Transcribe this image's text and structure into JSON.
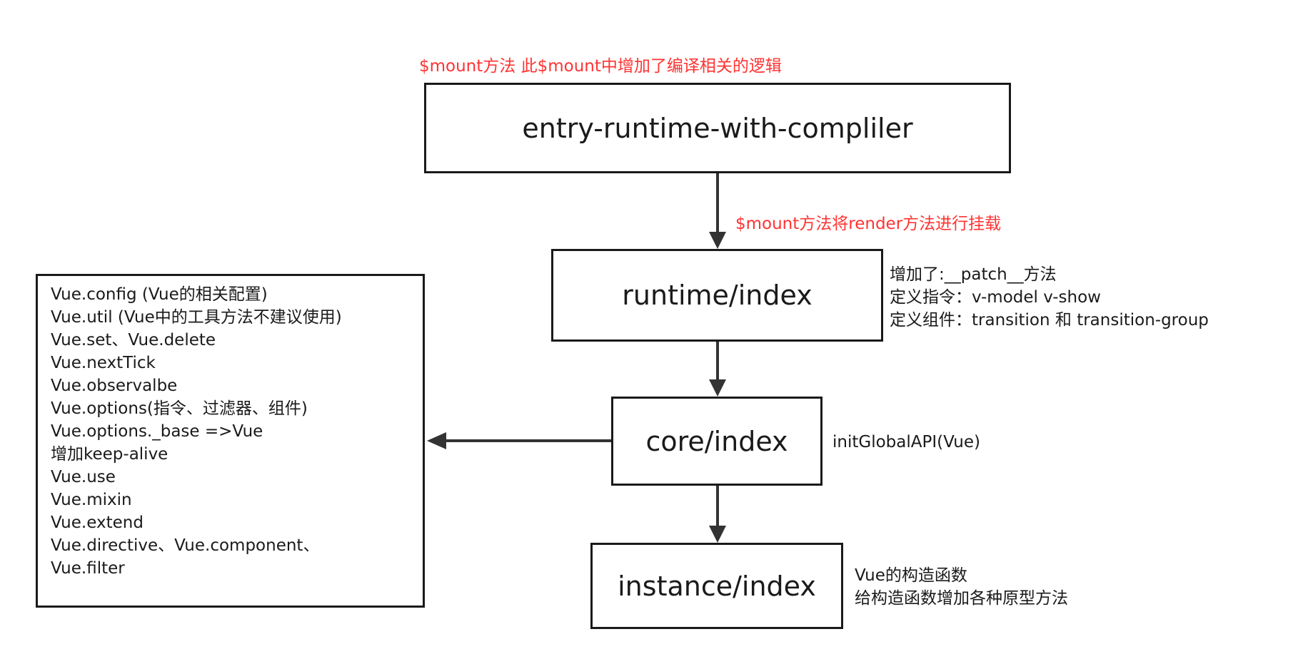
{
  "nodes": {
    "entry": "entry-runtime-with-compliler",
    "runtime": "runtime/index",
    "core": "core/index",
    "instance": "instance/index"
  },
  "annotations": {
    "top": "$mount方法 此$mount中增加了编译相关的逻辑",
    "mid": "$mount方法将render方法进行挂载",
    "runtime": [
      "增加了:__patch__方法",
      "定义指令：v-model v-show",
      "定义组件：transition 和 transition-group"
    ],
    "core": "initGlobalAPI(Vue)",
    "instance": [
      "Vue的构造函数",
      "给构造函数增加各种原型方法"
    ]
  },
  "api_list": [
    "Vue.config (Vue的相关配置)",
    "Vue.util (Vue中的工具方法不建议使用)",
    "Vue.set、Vue.delete",
    "Vue.nextTick",
    "Vue.observalbe",
    "Vue.options(指令、过滤器、组件)",
    "Vue.options._base =>Vue",
    "增加keep-alive",
    "Vue.use",
    "Vue.mixin",
    "Vue.extend",
    "Vue.directive、Vue.component、",
    "Vue.filter"
  ],
  "colors": {
    "annotation_red": "#ff3333",
    "stroke": "#1a1a1a",
    "text": "#1a1a1a"
  }
}
